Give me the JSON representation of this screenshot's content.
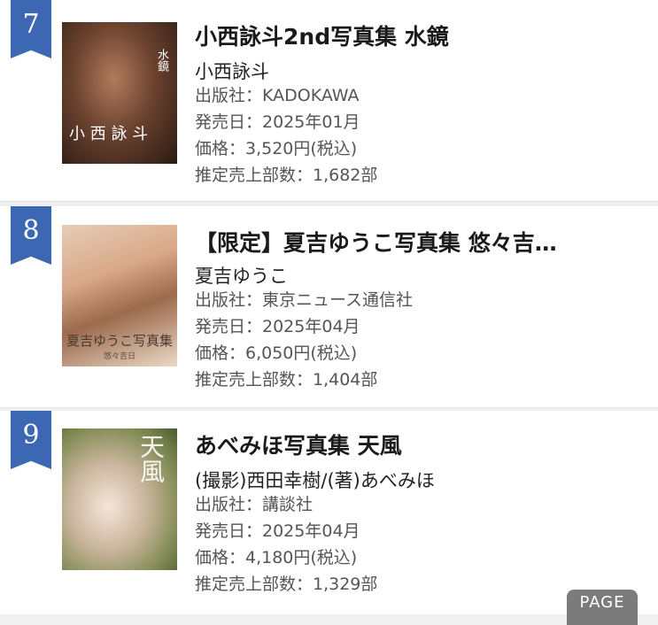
{
  "items": [
    {
      "rank": "7",
      "title": "小西詠斗2nd写真集 水鏡",
      "author": "小西詠斗",
      "publisher": "出版社：KADOKAWA",
      "release": "発売日：2025年01月",
      "price": "価格：3,520円(税込)",
      "sales": "推定売上部数：1,682部",
      "cover": {
        "side_text": "水鏡",
        "name_text": "小 西 詠 斗"
      }
    },
    {
      "rank": "8",
      "title": "【限定】夏吉ゆうこ写真集 悠々吉…",
      "author": "夏吉ゆうこ",
      "publisher": "出版社：東京ニュース通信社",
      "release": "発売日：2025年04月",
      "price": "価格：6,050円(税込)",
      "sales": "推定売上部数：1,404部",
      "cover": {
        "title_text": "夏吉ゆうこ写真集",
        "sub_text": "悠々吉日"
      }
    },
    {
      "rank": "9",
      "title": "あべみほ写真集 天風",
      "author": "(撮影)西田幸樹/(著)あべみほ",
      "publisher": "出版社：講談社",
      "release": "発売日：2025年04月",
      "price": "価格：4,180円(税込)",
      "sales": "推定売上部数：1,329部",
      "cover": {
        "title_text": "天風"
      }
    }
  ],
  "page_button": "PAGE",
  "colors": {
    "rank_ribbon": "#3b67b3",
    "background": "#f0f0f0"
  }
}
